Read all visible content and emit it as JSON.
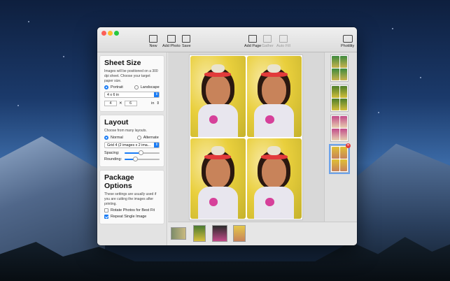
{
  "toolbar": {
    "new_label": "New",
    "add_photo_label": "Add Photo",
    "save_label": "Save",
    "add_page_label": "Add Page",
    "gather_label": "Gather",
    "auto_fill_label": "Auto Fill",
    "app_label": "Photility"
  },
  "sheet_size": {
    "title": "Sheet Size",
    "description": "Images will be positioned on a 300 dpi sheet. Choose your target paper size.",
    "portrait_label": "Portrait",
    "landscape_label": "Landscape",
    "orientation": "Portrait",
    "paper_size": "4 x 6 in",
    "width": "4",
    "times": "✕",
    "height": "6",
    "unit": "in"
  },
  "layout": {
    "title": "Layout",
    "description": "Choose from many layouts.",
    "normal_label": "Normal",
    "alternate_label": "Alternate",
    "mode": "Normal",
    "grid_option": "Grid 4 (2 images x 2 ima...",
    "spacing_label": "Spacing:",
    "spacing_value": 0.45,
    "rounding_label": "Rounding:",
    "rounding_value": 0.3
  },
  "package_options": {
    "title": "Package Options",
    "description": "These settings are usually used if you are cutting the images after printing.",
    "rotate_label": "Rotate Photos for Best Fit",
    "rotate_checked": false,
    "repeat_label": "Repeat Single Image",
    "repeat_checked": true
  },
  "page_thumbnails": {
    "count": 4,
    "selected_index": 3,
    "delete_badge": "✕"
  },
  "photo_strip": {
    "count": 4
  },
  "colors": {
    "accent": "#1a7cf5",
    "delete": "#e23a3a"
  },
  "icons": [
    "new-doc-icon",
    "add-photo-icon",
    "save-icon",
    "add-page-icon",
    "gather-icon",
    "auto-fill-icon",
    "photility-toolbox-icon"
  ]
}
